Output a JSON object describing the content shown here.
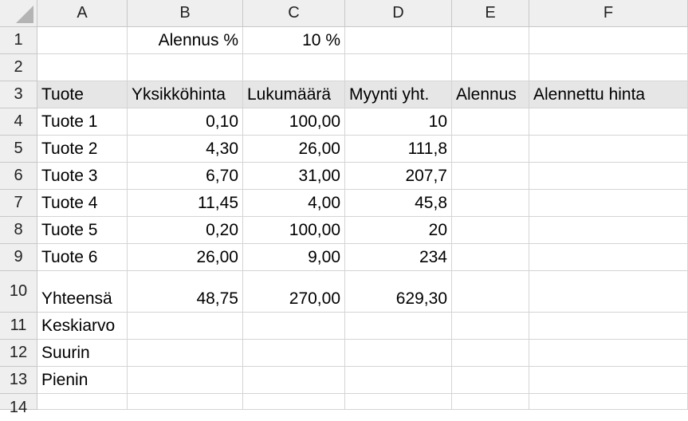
{
  "columns": [
    "A",
    "B",
    "C",
    "D",
    "E",
    "F"
  ],
  "row_numbers": [
    "1",
    "2",
    "3",
    "4",
    "5",
    "6",
    "7",
    "8",
    "9",
    "10",
    "11",
    "12",
    "13",
    "14"
  ],
  "cells": {
    "B1": "Alennus %",
    "C1": "10 %",
    "A3": "Tuote",
    "B3": "Yksikköhinta",
    "C3": "Lukumäärä",
    "D3": "Myynti yht.",
    "E3": "Alennus",
    "F3": "Alennettu hinta",
    "A4": "Tuote 1",
    "B4": "0,10",
    "C4": "100,00",
    "D4": "10",
    "A5": "Tuote 2",
    "B5": "4,30",
    "C5": "26,00",
    "D5": "111,8",
    "A6": "Tuote 3",
    "B6": "6,70",
    "C6": "31,00",
    "D6": "207,7",
    "A7": "Tuote 4",
    "B7": "11,45",
    "C7": "4,00",
    "D7": "45,8",
    "A8": "Tuote 5",
    "B8": "0,20",
    "C8": "100,00",
    "D8": "20",
    "A9": "Tuote 6",
    "B9": "26,00",
    "C9": "9,00",
    "D9": "234",
    "A10": "Yhteensä",
    "B10": "48,75",
    "C10": "270,00",
    "D10": "629,30",
    "A11": "Keskiarvo",
    "A12": "Suurin",
    "A13": "Pienin"
  }
}
